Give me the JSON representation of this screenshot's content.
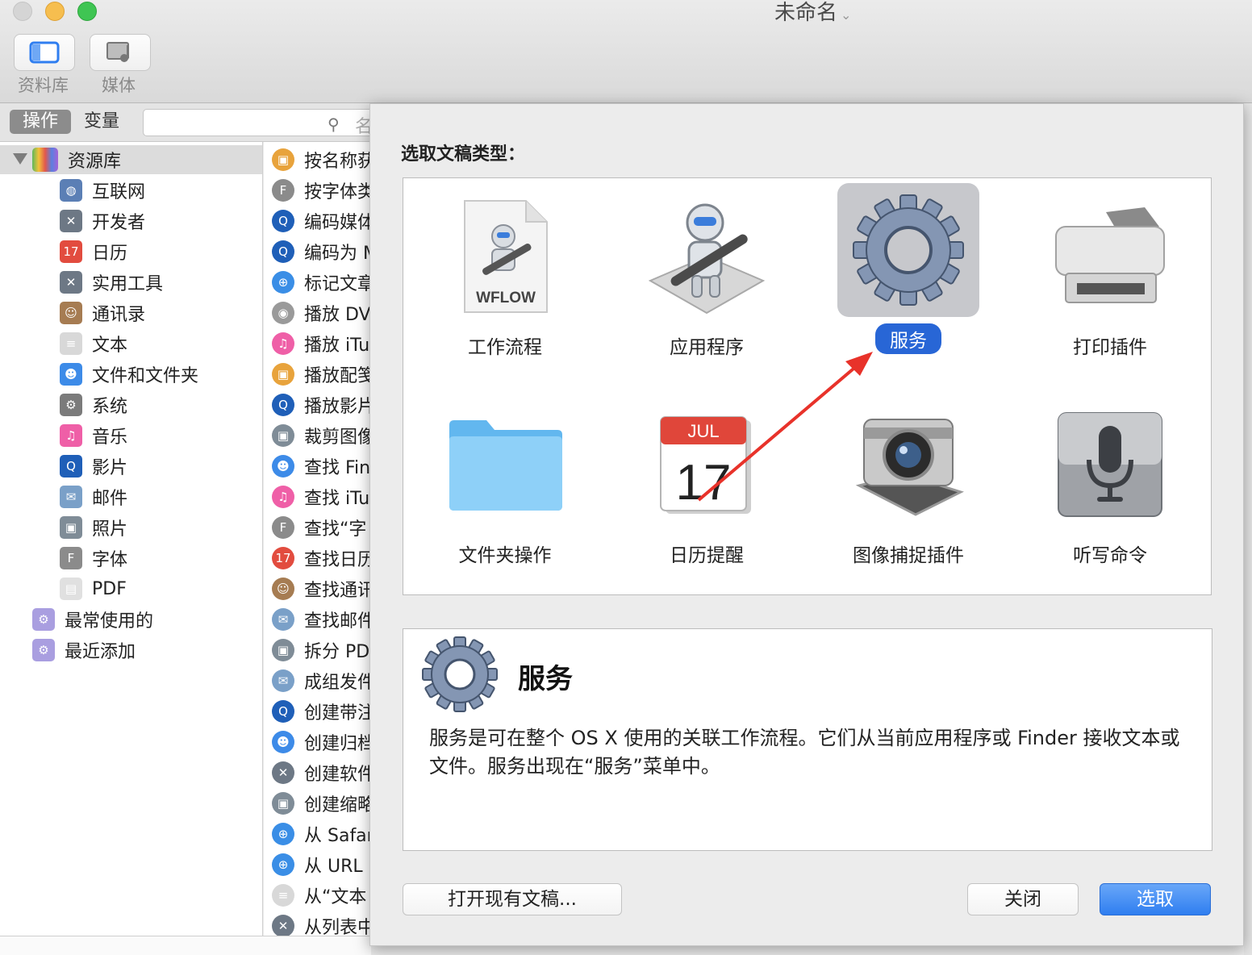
{
  "window": {
    "title": "未命名"
  },
  "toolbar": {
    "library_label": "资料库",
    "media_label": "媒体"
  },
  "filter": {
    "actions_tab": "操作",
    "variables_tab": "变量",
    "search_placeholder": "名"
  },
  "library": {
    "root_label": "资源库",
    "items": [
      {
        "label": "互联网",
        "icon": "globe-icon",
        "color": "#5b7fb5"
      },
      {
        "label": "开发者",
        "icon": "tools-icon",
        "color": "#6d7885"
      },
      {
        "label": "日历",
        "icon": "calendar-icon",
        "color": "#e24c3f"
      },
      {
        "label": "实用工具",
        "icon": "tools-icon",
        "color": "#6d7885"
      },
      {
        "label": "通讯录",
        "icon": "contacts-icon",
        "color": "#a67c52"
      },
      {
        "label": "文本",
        "icon": "text-icon",
        "color": "#d8d8d8"
      },
      {
        "label": "文件和文件夹",
        "icon": "finder-icon",
        "color": "#3d8be8"
      },
      {
        "label": "系统",
        "icon": "gear-icon",
        "color": "#7b7b7b"
      },
      {
        "label": "音乐",
        "icon": "music-icon",
        "color": "#ef5fa7"
      },
      {
        "label": "影片",
        "icon": "quicktime-icon",
        "color": "#1f5fb8"
      },
      {
        "label": "邮件",
        "icon": "mail-icon",
        "color": "#7aa0c8"
      },
      {
        "label": "照片",
        "icon": "photos-icon",
        "color": "#7f8c97"
      },
      {
        "label": "字体",
        "icon": "font-icon",
        "color": "#8b8b8b"
      },
      {
        "label": "PDF",
        "icon": "pdf-icon",
        "color": "#e0e0e0"
      }
    ],
    "smart_groups": [
      {
        "label": "最常使用的",
        "icon": "smart-folder-icon",
        "color": "#a99ee0"
      },
      {
        "label": "最近添加",
        "icon": "smart-folder-icon",
        "color": "#a99ee0"
      }
    ]
  },
  "actions": [
    {
      "label": "按名称获",
      "icon": "photos-icon",
      "color": "#e8a33c"
    },
    {
      "label": "按字体类",
      "icon": "font-icon",
      "color": "#8b8b8b"
    },
    {
      "label": "编码媒体",
      "icon": "quicktime-icon",
      "color": "#1f5fb8"
    },
    {
      "label": "编码为 M",
      "icon": "quicktime-icon",
      "color": "#1f5fb8"
    },
    {
      "label": "标记文章",
      "icon": "safari-icon",
      "color": "#3a8ee6"
    },
    {
      "label": "播放 DV",
      "icon": "dvd-icon",
      "color": "#9a9a9a"
    },
    {
      "label": "播放 iTu",
      "icon": "music-icon",
      "color": "#ef5fa7"
    },
    {
      "label": "播放配笺",
      "icon": "photos-icon",
      "color": "#e8a33c"
    },
    {
      "label": "播放影片",
      "icon": "quicktime-icon",
      "color": "#1f5fb8"
    },
    {
      "label": "裁剪图像",
      "icon": "photos-icon",
      "color": "#7f8c97"
    },
    {
      "label": "查找 Fin",
      "icon": "finder-icon",
      "color": "#3d8be8"
    },
    {
      "label": "查找 iTu",
      "icon": "music-icon",
      "color": "#ef5fa7"
    },
    {
      "label": "查找“字",
      "icon": "font-icon",
      "color": "#8b8b8b"
    },
    {
      "label": "查找日历",
      "icon": "calendar-icon",
      "color": "#e24c3f"
    },
    {
      "label": "查找通讯",
      "icon": "contacts-icon",
      "color": "#a67c52"
    },
    {
      "label": "查找邮件",
      "icon": "mail-icon",
      "color": "#7aa0c8"
    },
    {
      "label": "拆分 PD",
      "icon": "photos-icon",
      "color": "#7f8c97"
    },
    {
      "label": "成组发件",
      "icon": "mail-icon",
      "color": "#7aa0c8"
    },
    {
      "label": "创建带注",
      "icon": "quicktime-icon",
      "color": "#1f5fb8"
    },
    {
      "label": "创建归档",
      "icon": "finder-icon",
      "color": "#3d8be8"
    },
    {
      "label": "创建软件",
      "icon": "tools-icon",
      "color": "#6d7885"
    },
    {
      "label": "创建缩略",
      "icon": "photos-icon",
      "color": "#7f8c97"
    },
    {
      "label": "从 Safar",
      "icon": "safari-icon",
      "color": "#3a8ee6"
    },
    {
      "label": "从 URL",
      "icon": "safari-icon",
      "color": "#3a8ee6"
    },
    {
      "label": "从“文本",
      "icon": "text-icon",
      "color": "#d8d8d8"
    },
    {
      "label": "从列表中",
      "icon": "tools-icon",
      "color": "#6d7885"
    }
  ],
  "sheet": {
    "prompt": "选取文稿类型：",
    "types": [
      {
        "label": "工作流程",
        "icon": "workflow-file-icon",
        "badge": "WFLOW"
      },
      {
        "label": "应用程序",
        "icon": "automator-robot-icon"
      },
      {
        "label": "服务",
        "icon": "gear-icon",
        "selected": true
      },
      {
        "label": "打印插件",
        "icon": "printer-icon"
      },
      {
        "label": "文件夹操作",
        "icon": "folder-icon"
      },
      {
        "label": "日历提醒",
        "icon": "calendar-icon",
        "month": "JUL",
        "day": "17"
      },
      {
        "label": "图像捕捉插件",
        "icon": "camera-icon"
      },
      {
        "label": "听写命令",
        "icon": "microphone-icon"
      }
    ],
    "description": {
      "title": "服务",
      "text": "服务是可在整个 OS X 使用的关联工作流程。它们从当前应用程序或 Finder 接收文本或文件。服务出现在“服务”菜单中。"
    },
    "buttons": {
      "open_existing": "打开现有文稿...",
      "close": "关闭",
      "choose": "选取"
    }
  },
  "colors": {
    "accent": "#2866d6",
    "annotation_arrow": "#e8322a"
  }
}
